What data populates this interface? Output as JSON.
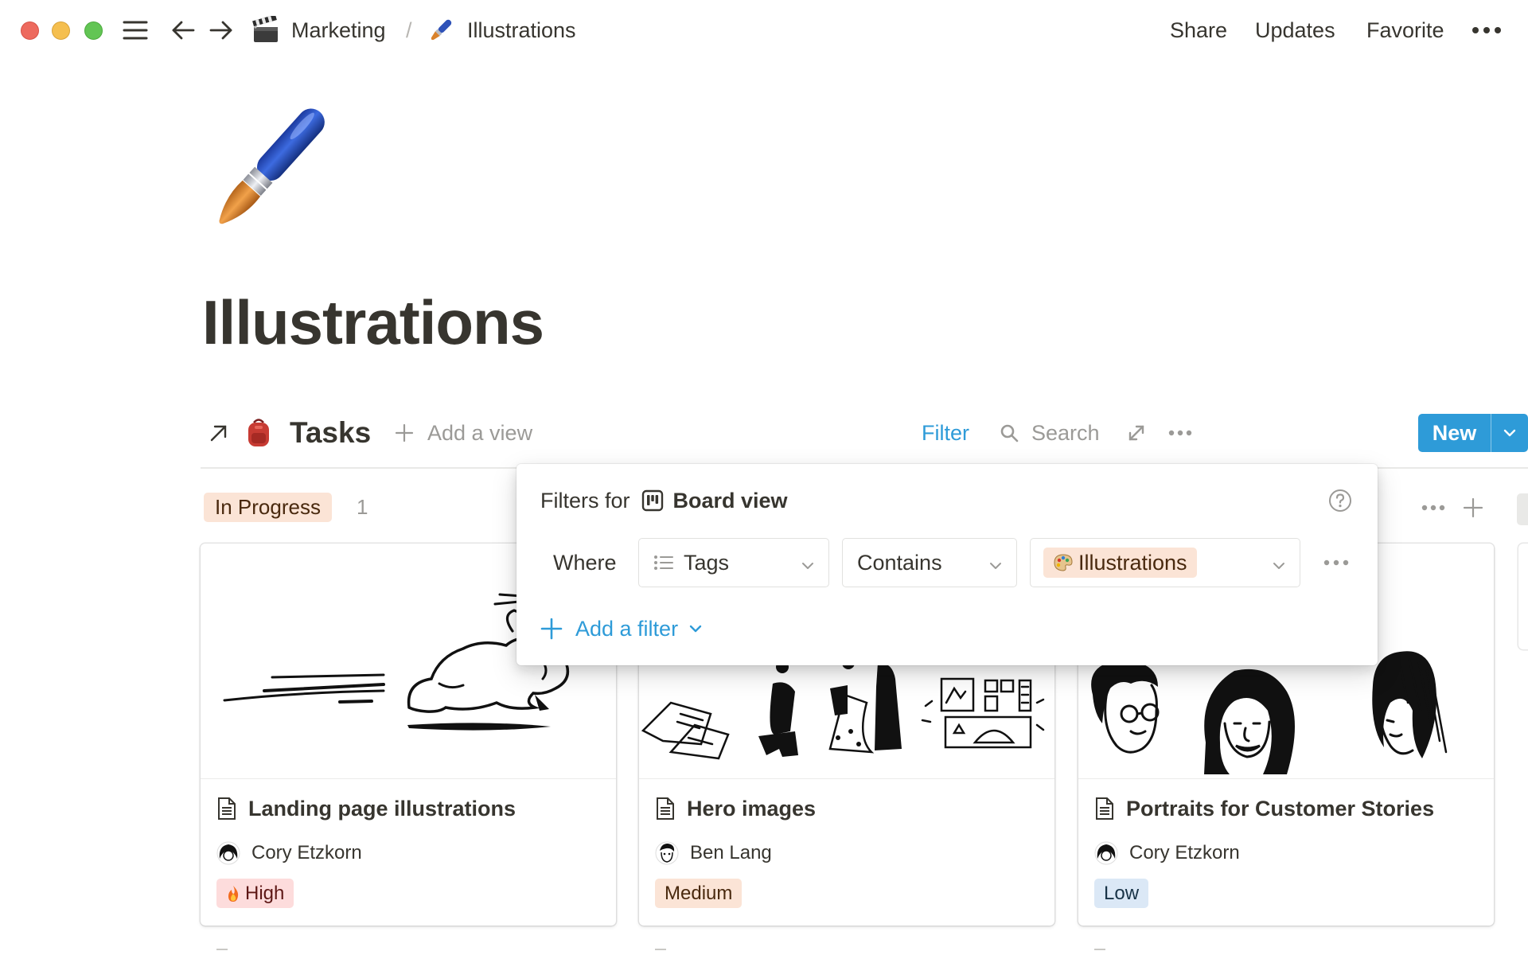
{
  "window": {
    "breadcrumb": [
      {
        "icon": "clapper-board-icon",
        "label": "Marketing"
      },
      {
        "icon": "paintbrush-icon",
        "label": "Illustrations"
      }
    ],
    "separator": "/",
    "actions": {
      "share": "Share",
      "updates": "Updates",
      "favorite": "Favorite"
    }
  },
  "page": {
    "icon": "paintbrush-icon",
    "title": "Illustrations"
  },
  "database": {
    "icon": "backpack-icon",
    "name": "Tasks",
    "add_view": "Add a view",
    "filter": "Filter",
    "search": "Search",
    "new": "New",
    "colors": {
      "accent": "#2e9bd8"
    }
  },
  "board": {
    "group": {
      "label": "In Progress",
      "count": "1"
    },
    "cards": [
      {
        "title": "Landing page illustrations",
        "person": "Cory Etzkorn",
        "priority": "High",
        "priority_icon": "fire-icon",
        "cover": "rabbit-illustration"
      },
      {
        "title": "Hero images",
        "person": "Ben Lang",
        "priority": "Medium",
        "cover": "people-and-paper-illustration"
      },
      {
        "title": "Portraits for Customer Stories",
        "person": "Cory Etzkorn",
        "priority": "Low",
        "cover": "portraits-illustration"
      }
    ]
  },
  "filter_popover": {
    "prefix": "Filters for",
    "view_name": "Board view",
    "where": "Where",
    "property": "Tags",
    "operator": "Contains",
    "value": "Illustrations",
    "value_icon": "palette-icon",
    "add_filter": "Add a filter"
  }
}
